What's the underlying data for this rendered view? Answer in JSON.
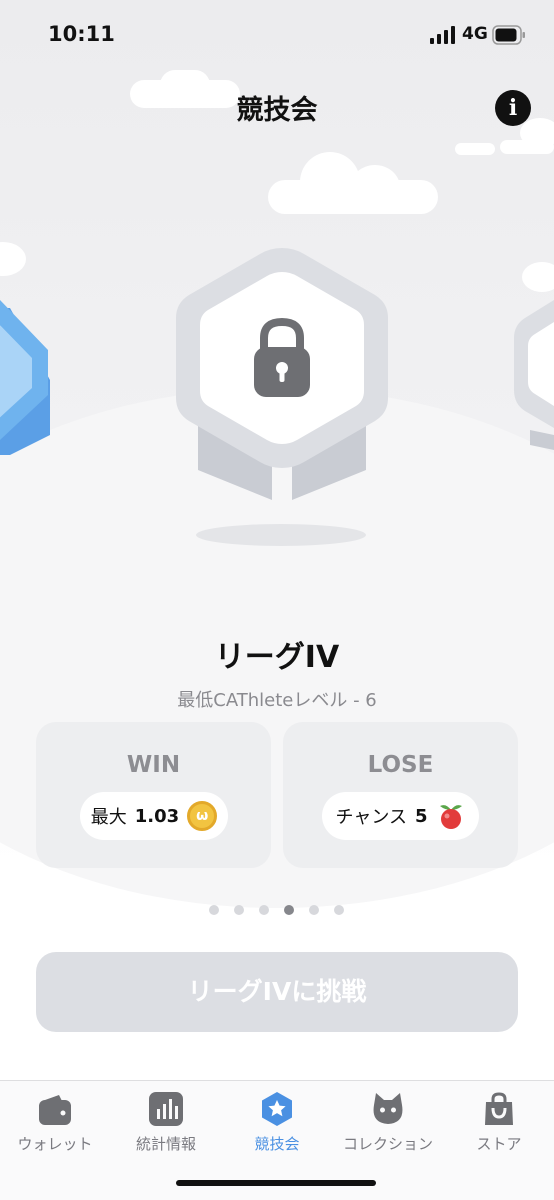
{
  "status_bar": {
    "time": "10:11",
    "network": "4G"
  },
  "header": {
    "title": "競技会",
    "info_icon": "info-icon"
  },
  "league": {
    "name": "リーグIV",
    "requirement": "最低CAThleteレベル - 6",
    "badge_icon": "lock-icon"
  },
  "rewards": {
    "win": {
      "title": "WIN",
      "label": "最大",
      "value": "1.03",
      "icon": "coin-icon",
      "coin_glyph": "ω"
    },
    "lose": {
      "title": "LOSE",
      "label": "チャンス",
      "value": "5",
      "icon": "berry-icon"
    }
  },
  "pagination": {
    "total": 6,
    "current_index": 3
  },
  "cta": {
    "label": "リーグIVに挑戦",
    "enabled": false
  },
  "tabs": [
    {
      "label": "ウォレット",
      "icon": "wallet-icon",
      "active": false
    },
    {
      "label": "統計情報",
      "icon": "stats-icon",
      "active": false
    },
    {
      "label": "競技会",
      "icon": "competition-icon",
      "active": true
    },
    {
      "label": "コレクション",
      "icon": "cat-icon",
      "active": false
    },
    {
      "label": "ストア",
      "icon": "shopping-bag-icon",
      "active": false
    }
  ],
  "colors": {
    "accent": "#4a90e2",
    "disabled_button": "#dcdee3",
    "card_bg": "#edeef0",
    "badge_gray": "#dcdee3",
    "left_badge_blue": "#6fb3ee"
  }
}
